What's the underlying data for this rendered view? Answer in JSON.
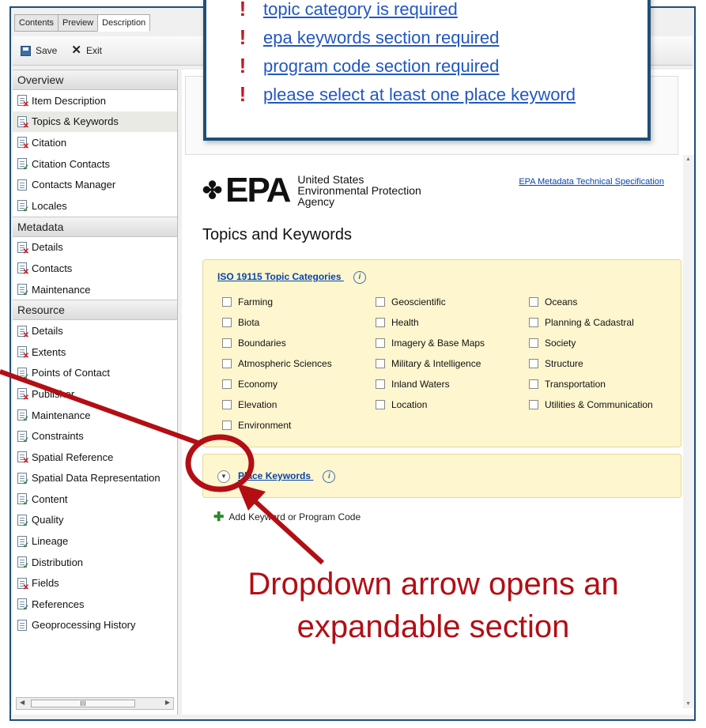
{
  "tabs": [
    "Contents",
    "Preview",
    "Description"
  ],
  "toolbar": {
    "save": "Save",
    "exit": "Exit"
  },
  "sidebar": {
    "sections": [
      {
        "title": "Overview",
        "items": [
          {
            "label": "Item Description",
            "status": "error"
          },
          {
            "label": "Topics & Keywords",
            "status": "error",
            "selected": true
          },
          {
            "label": "Citation",
            "status": "error"
          },
          {
            "label": "Citation Contacts",
            "status": "ok"
          },
          {
            "label": "Contacts Manager",
            "status": "none"
          },
          {
            "label": "Locales",
            "status": "ok"
          }
        ]
      },
      {
        "title": "Metadata",
        "items": [
          {
            "label": "Details",
            "status": "error"
          },
          {
            "label": "Contacts",
            "status": "error"
          },
          {
            "label": "Maintenance",
            "status": "ok"
          }
        ]
      },
      {
        "title": "Resource",
        "items": [
          {
            "label": "Details",
            "status": "error"
          },
          {
            "label": "Extents",
            "status": "error"
          },
          {
            "label": "Points of Contact",
            "status": "ok"
          },
          {
            "label": "Publisher",
            "status": "error"
          },
          {
            "label": "Maintenance",
            "status": "ok"
          },
          {
            "label": "Constraints",
            "status": "ok"
          },
          {
            "label": "Spatial Reference",
            "status": "error"
          },
          {
            "label": "Spatial Data Representation",
            "status": "ok"
          },
          {
            "label": "Content",
            "status": "ok"
          },
          {
            "label": "Quality",
            "status": "ok"
          },
          {
            "label": "Lineage",
            "status": "ok"
          },
          {
            "label": "Distribution",
            "status": "ok"
          },
          {
            "label": "Fields",
            "status": "error"
          },
          {
            "label": "References",
            "status": "ok"
          },
          {
            "label": "Geoprocessing History",
            "status": "none"
          }
        ]
      }
    ],
    "scroll_thumb": "III"
  },
  "epa": {
    "logo": "EPA",
    "agency": [
      "United States",
      "Environmental Protection",
      "Agency"
    ],
    "spec_link": "EPA Metadata Technical Specification"
  },
  "page_title": "Topics and Keywords",
  "topics": {
    "heading": "ISO 19115 Topic Categories",
    "info": "i",
    "columns": [
      [
        "Farming",
        "Biota",
        "Boundaries",
        "Atmospheric Sciences",
        "Economy",
        "Elevation",
        "Environment"
      ],
      [
        "Geoscientific",
        "Health",
        "Imagery & Base Maps",
        "Military & Intelligence",
        "Inland Waters",
        "Location"
      ],
      [
        "Oceans",
        "Planning & Cadastral",
        "Society",
        "Structure",
        "Transportation",
        "Utilities & Communication"
      ]
    ]
  },
  "place_keywords": {
    "label": "Place Keywords",
    "info": "i"
  },
  "add_keyword": "Add Keyword or Program Code",
  "errors": [
    "topic category is required",
    "epa keywords section required",
    "program code section required",
    "please select at least one place keyword"
  ],
  "annotation": {
    "line1": "Dropdown arrow opens an",
    "line2": "expandable section",
    "color": "#b30e14"
  }
}
